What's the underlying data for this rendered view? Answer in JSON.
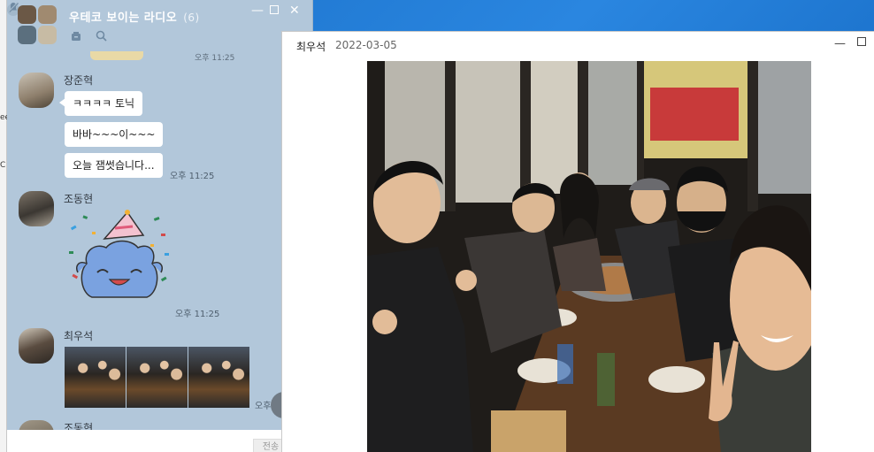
{
  "desktop": {
    "left_fragment_1": "ee",
    "left_fragment_2": "C"
  },
  "chat": {
    "room_title": "우테코 보이는 라디오",
    "member_count": "(6)",
    "icons": [
      "drawer-icon",
      "search-icon",
      "mute-icon",
      "minimize-icon",
      "maximize-icon",
      "close-icon"
    ],
    "partial_time": "오후 11:25",
    "messages": [
      {
        "sender": "장준혁",
        "bubbles": [
          "ㅋㅋㅋㅋ 토닉",
          "바바~~~이~~~",
          "오늘 잼썻습니다..."
        ],
        "time": "오후 11:25"
      },
      {
        "sender": "조동현",
        "sticker": "party-hat-blob-sticker",
        "time": "오후 11:25"
      },
      {
        "sender": "최우석",
        "photos": 3,
        "time": "오후"
      },
      {
        "sender": "조동현"
      }
    ],
    "send_label": "전송",
    "colors": {
      "background": "#b2c7da",
      "bubble": "#ffffff"
    }
  },
  "viewer": {
    "sender": "최우석",
    "date": "2022-03-05",
    "image_description": "group selfie photo"
  }
}
